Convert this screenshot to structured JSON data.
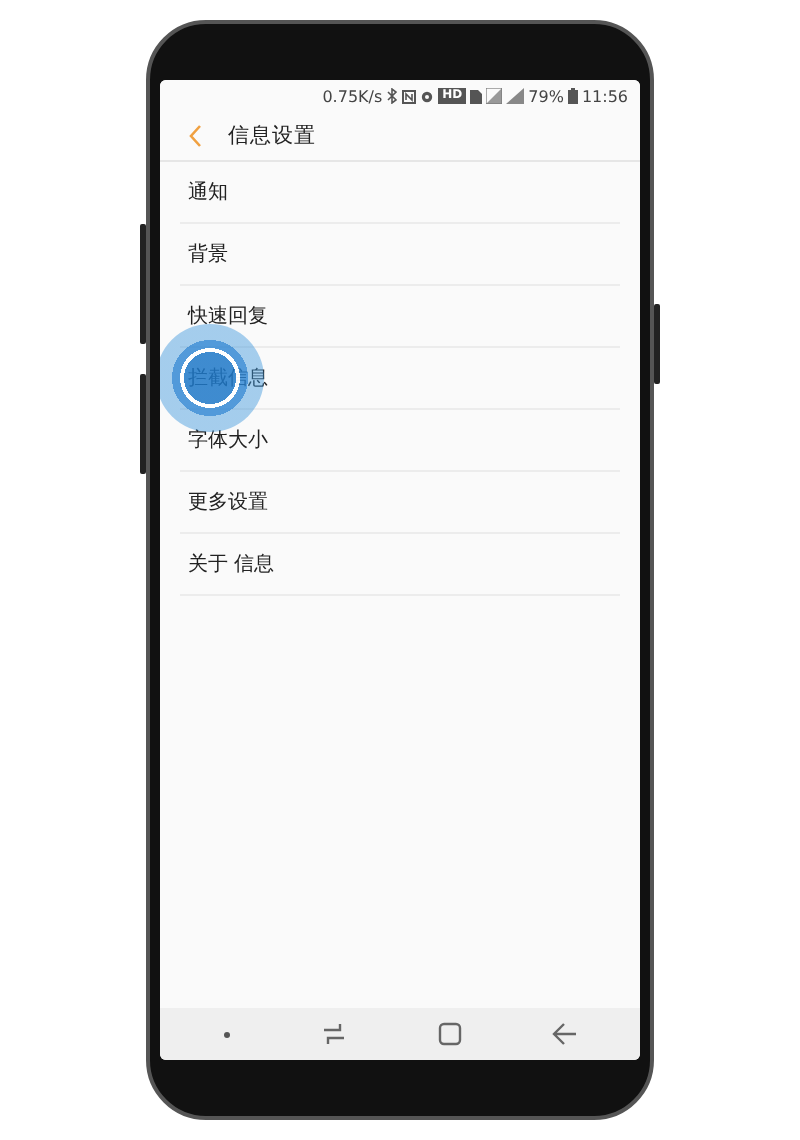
{
  "status_bar": {
    "speed": "0.75K/s",
    "hd_badge": "HD",
    "battery": "79%",
    "time": "11:56"
  },
  "header": {
    "title": "信息设置"
  },
  "items": [
    {
      "label": "通知",
      "tapped": false
    },
    {
      "label": "背景",
      "tapped": false
    },
    {
      "label": "快速回复",
      "tapped": false
    },
    {
      "label": "拦截信息",
      "tapped": true
    },
    {
      "label": "字体大小",
      "tapped": false
    },
    {
      "label": "更多设置",
      "tapped": false
    },
    {
      "label": "关于 信息",
      "tapped": false
    }
  ]
}
